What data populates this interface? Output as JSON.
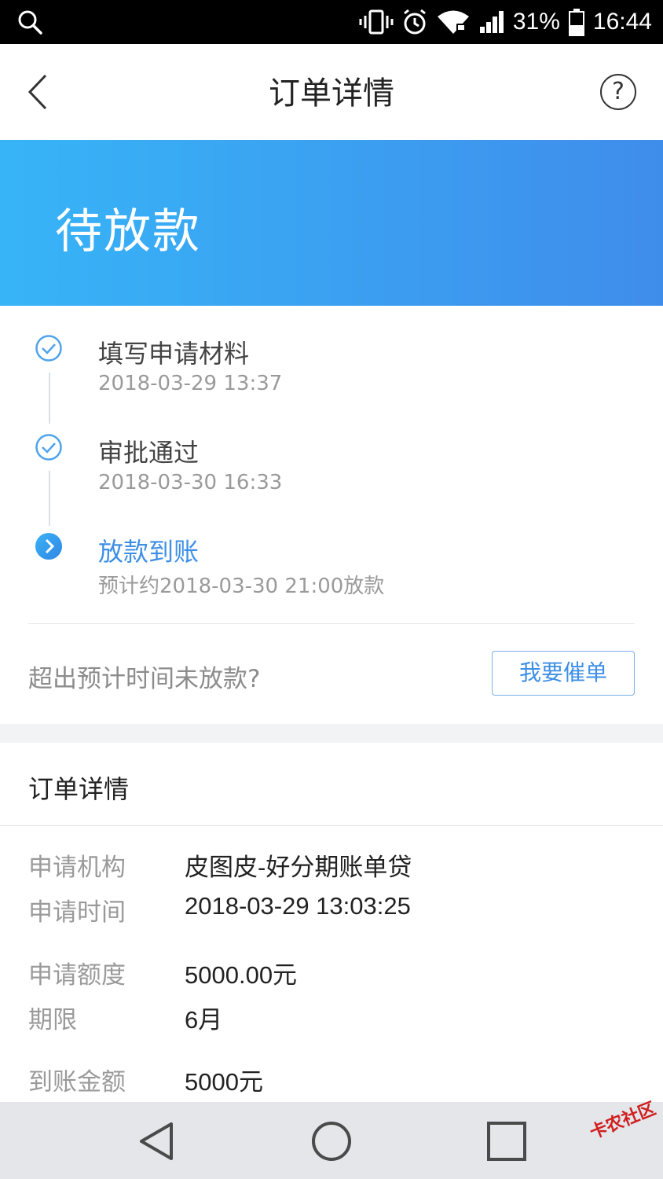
{
  "status_bar": {
    "battery": "31%",
    "time": "16:44"
  },
  "header": {
    "title": "订单详情"
  },
  "banner": {
    "status": "待放款"
  },
  "timeline": [
    {
      "title": "填写申请材料",
      "time": "2018-03-29 13:37",
      "state": "done"
    },
    {
      "title": "审批通过",
      "time": "2018-03-30 16:33",
      "state": "done"
    },
    {
      "title": "放款到账",
      "time": "预计约2018-03-30 21:00放款",
      "state": "current"
    }
  ],
  "urge": {
    "question": "超出预计时间未放款?",
    "button": "我要催单"
  },
  "order_details": {
    "title": "订单详情",
    "rows": [
      {
        "label": "申请机构",
        "value": "皮图皮-好分期账单贷"
      },
      {
        "label": "申请时间",
        "value": "2018-03-29 13:03:25"
      },
      {
        "label": "申请额度",
        "value": "5000.00元"
      },
      {
        "label": "期限",
        "value": "6月"
      },
      {
        "label": "到账金额",
        "value": "5000元"
      }
    ]
  },
  "watermark": "卡农社区",
  "colors": {
    "accent": "#3d8fe6",
    "banner_start": "#37b4f7",
    "banner_end": "#3f8deb"
  }
}
